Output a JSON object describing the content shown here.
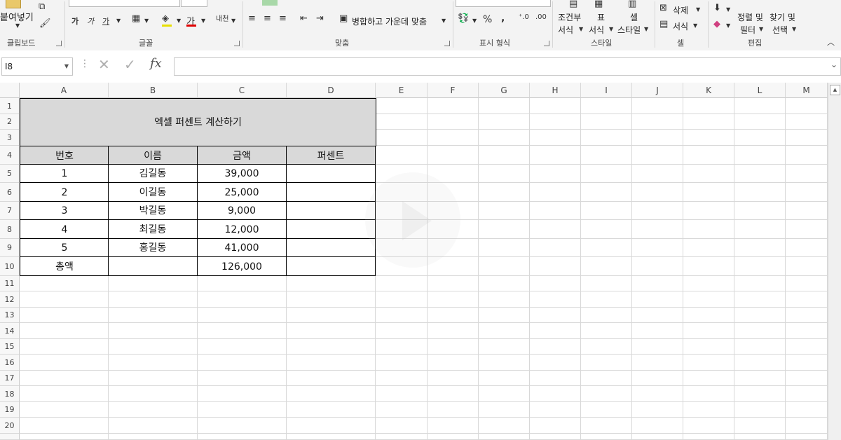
{
  "ribbon": {
    "clipboard": {
      "paste_label": "붙여넣기",
      "group_label": "클립보드"
    },
    "font": {
      "group_label": "글꼴",
      "bold": "가",
      "italic": "가",
      "underline": "가",
      "font_color_glyph": "가",
      "phonetic": "내천"
    },
    "alignment": {
      "merge_center_label": "병합하고 가운데 맞춤",
      "group_label": "맞춤"
    },
    "number": {
      "percent": "%",
      "comma": ",",
      "group_label": "표시 형식"
    },
    "styles": {
      "conditional_line1": "조건부",
      "conditional_line2": "서식",
      "table_line1": "표",
      "table_line2": "서식",
      "cell_line1": "셀",
      "cell_line2": "스타일",
      "group_label": "스타일"
    },
    "cells": {
      "delete_label": "삭제",
      "format_label": "서식",
      "group_label": "셀"
    },
    "editing": {
      "sort_line1": "정렬 및",
      "sort_line2": "필터",
      "find_line1": "찾기 및",
      "find_line2": "선택",
      "group_label": "편집"
    }
  },
  "formula_bar": {
    "name_box": "I8",
    "formula": ""
  },
  "columns": [
    "A",
    "B",
    "C",
    "D",
    "E",
    "F",
    "G",
    "H",
    "I",
    "J",
    "K",
    "L",
    "M"
  ],
  "rows": [
    "1",
    "2",
    "3",
    "4",
    "5",
    "6",
    "7",
    "8",
    "9",
    "10",
    "11",
    "12",
    "13",
    "14",
    "15",
    "16",
    "17",
    "18",
    "19",
    "20"
  ],
  "sheet": {
    "title": "엑셀 퍼센트 계산하기",
    "headers": [
      "번호",
      "이름",
      "금액",
      "퍼센트"
    ],
    "data": [
      [
        "1",
        "김길동",
        "39,000",
        ""
      ],
      [
        "2",
        "이길동",
        "25,000",
        ""
      ],
      [
        "3",
        "박길동",
        "9,000",
        ""
      ],
      [
        "4",
        "최길동",
        "12,000",
        ""
      ],
      [
        "5",
        "홍길동",
        "41,000",
        ""
      ]
    ],
    "total": [
      "총액",
      "",
      "126,000",
      ""
    ]
  },
  "colors": {
    "header_fill": "#d9d9d9",
    "ribbon_bg": "#f3f3f3",
    "grid_line": "#d8d8d8"
  }
}
